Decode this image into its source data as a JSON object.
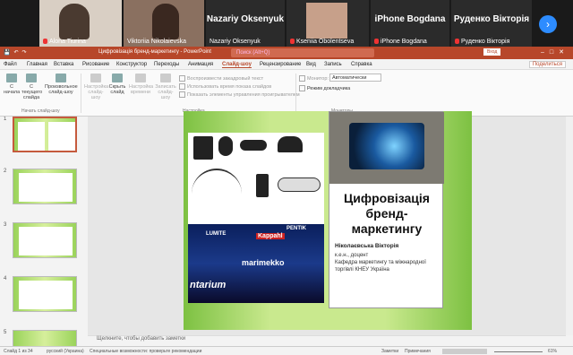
{
  "participants": [
    {
      "name": "Alona Tiurina",
      "muted": true
    },
    {
      "name": "Viktoriia Nikolaievska",
      "muted": false
    },
    {
      "name": "Nazariy Oksenyuk",
      "muted": false,
      "big": "Nazariy Oksenyuk"
    },
    {
      "name": "Kseniia Obolentseva",
      "muted": true
    },
    {
      "name": "iPhone Bogdana",
      "muted": true,
      "big": "iPhone Bogdana"
    },
    {
      "name": "Руденко Вікторія",
      "muted": true,
      "big": "Руденко Вікторія"
    }
  ],
  "app": {
    "title": "Цифровізація бренд-маркетингу - PowerPoint",
    "search_placeholder": "Поиск (Alt+Q)",
    "signin": "Вход",
    "share": "Поделиться"
  },
  "menu": [
    "Файл",
    "Главная",
    "Вставка",
    "Рисование",
    "Конструктор",
    "Переходы",
    "Анимация",
    "Слайд-шоу",
    "Рецензирование",
    "Вид",
    "Запись",
    "Справка"
  ],
  "active_menu": "Слайд-шоу",
  "ribbon": {
    "btn_from_start": "С начала",
    "btn_current": "С текущего слайда",
    "btn_online": "Произвольное слайд-шоу",
    "btn_settings": "Настройка слайд-шоу",
    "btn_hide": "Скрыть слайд",
    "btn_rehearse": "Настройка времени",
    "btn_record": "Записать слайд-шоу",
    "group_start": "Начать слайд-шоу",
    "group_setup": "Настройка",
    "group_monitors": "Мониторы",
    "chk_narrations": "Воспроизвести закадровый текст",
    "chk_timings": "Использовать время показа слайдов",
    "chk_controls": "Показать элементы управления проигрывателем",
    "chk_monitor": "Монитор:",
    "monitor_value": "Автоматически",
    "chk_presenter": "Режим докладчика"
  },
  "slides": [
    1,
    2,
    3,
    4,
    5
  ],
  "slide": {
    "title": "Цифровізація бренд-маркетингу",
    "author": "Ніколаєвська Вікторія",
    "affiliation_line1": "к.е.н., доцент",
    "affiliation_line2": "Кафедра маркетингу та міжнародної торгівлі КНЕУ Україна",
    "sign1": "PENTIK",
    "sign2": "Kappahl",
    "sign3": "LUMITE",
    "sign4": "marimekko",
    "sign5": "ntarium"
  },
  "notes_placeholder": "Щелкните, чтобы добавить заметки",
  "status": {
    "slide_count": "Слайд 1 из 34",
    "language": "русский (Украина)",
    "accessibility": "Специальные возможности: проверьте рекомендации",
    "notes": "Заметки",
    "comments": "Примечания",
    "zoom": "61%"
  }
}
